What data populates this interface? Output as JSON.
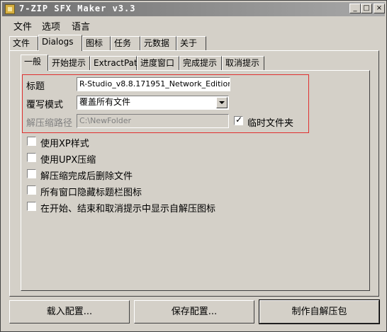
{
  "window": {
    "title": "7-ZIP SFX Maker v3.3",
    "controls": {
      "minimize": "_",
      "maximize": "□",
      "close": "×"
    }
  },
  "menu": [
    "文件",
    "选项",
    "语言"
  ],
  "top_tabs": [
    {
      "label": "文件"
    },
    {
      "label": "Dialogs"
    },
    {
      "label": "图标"
    },
    {
      "label": "任务"
    },
    {
      "label": "元数据"
    },
    {
      "label": "关于"
    }
  ],
  "top_tabs_active": "Dialogs",
  "sub_tabs": [
    {
      "label": "一般"
    },
    {
      "label": "开始提示"
    },
    {
      "label": "ExtractPath"
    },
    {
      "label": "进度窗口"
    },
    {
      "label": "完成提示"
    },
    {
      "label": "取消提示"
    }
  ],
  "sub_tabs_active": "一般",
  "general": {
    "title_label": "标题",
    "title_value": "R-Studio_v8.8.171951_Network_Edition",
    "overwrite_label": "覆写模式",
    "overwrite_value": "覆盖所有文件",
    "extract_path_label": "解压缩路径",
    "extract_path_value": "C:\\NewFolder",
    "temp_folder_label": "临时文件夹",
    "temp_folder_checked": true
  },
  "options": [
    {
      "label": "使用XP样式",
      "checked": false
    },
    {
      "label": "使用UPX压缩",
      "checked": false
    },
    {
      "label": "解压缩完成后删除文件",
      "checked": false
    },
    {
      "label": "所有窗口隐藏标题栏图标",
      "checked": false
    },
    {
      "label": "在开始、结束和取消提示中显示自解压图标",
      "checked": false
    }
  ],
  "buttons": {
    "load_config": "载入配置...",
    "save_config": "保存配置...",
    "make_sfx": "制作自解压包"
  },
  "colors": {
    "face": "#d4d0c8",
    "highlight_box": "#e03030"
  }
}
